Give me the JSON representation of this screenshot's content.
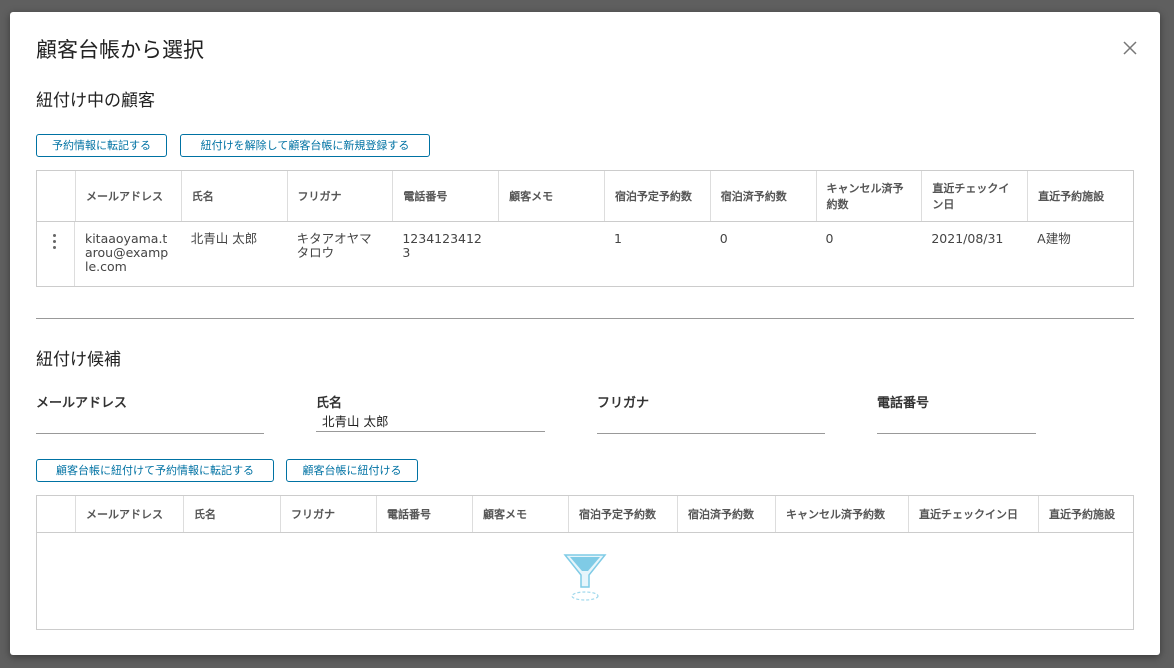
{
  "modal": {
    "title": "顧客台帳から選択"
  },
  "linked_section": {
    "title": "紐付け中の顧客",
    "buttons": {
      "transfer": "予約情報に転記する",
      "unlink_register": "紐付けを解除して顧客台帳に新規登録する"
    },
    "columns": [
      "メールアドレス",
      "氏名",
      "フリガナ",
      "電話番号",
      "顧客メモ",
      "宿泊予定予約数",
      "宿泊済予約数",
      "キャンセル済予約数",
      "直近チェックイン日",
      "直近予約施設"
    ],
    "row": {
      "email": "kitaaoyama.tarou@example.com",
      "name": "北青山 太郎",
      "kana": "キタアオヤマタロウ",
      "phone": "12341234123",
      "memo": "",
      "planned": "1",
      "stayed": "0",
      "cancelled": "0",
      "last_checkin": "2021/08/31",
      "last_facility": "A建物"
    }
  },
  "candidates_section": {
    "title": "紐付け候補",
    "filters": {
      "email_label": "メールアドレス",
      "email_value": "",
      "name_label": "氏名",
      "name_value": "北青山 太郎",
      "kana_label": "フリガナ",
      "kana_value": "",
      "phone_label": "電話番号",
      "phone_value": ""
    },
    "buttons": {
      "link_transfer": "顧客台帳に紐付けて予約情報に転記する",
      "link": "顧客台帳に紐付ける"
    },
    "columns": [
      "メールアドレス",
      "氏名",
      "フリガナ",
      "電話番号",
      "顧客メモ",
      "宿泊予定予約数",
      "宿泊済予約数",
      "キャンセル済予約数",
      "直近チェックイン日",
      "直近予約施設"
    ],
    "empty_icon": "funnel-icon"
  },
  "colors": {
    "accent": "#0072a3",
    "funnel": "#7fcbe6"
  }
}
